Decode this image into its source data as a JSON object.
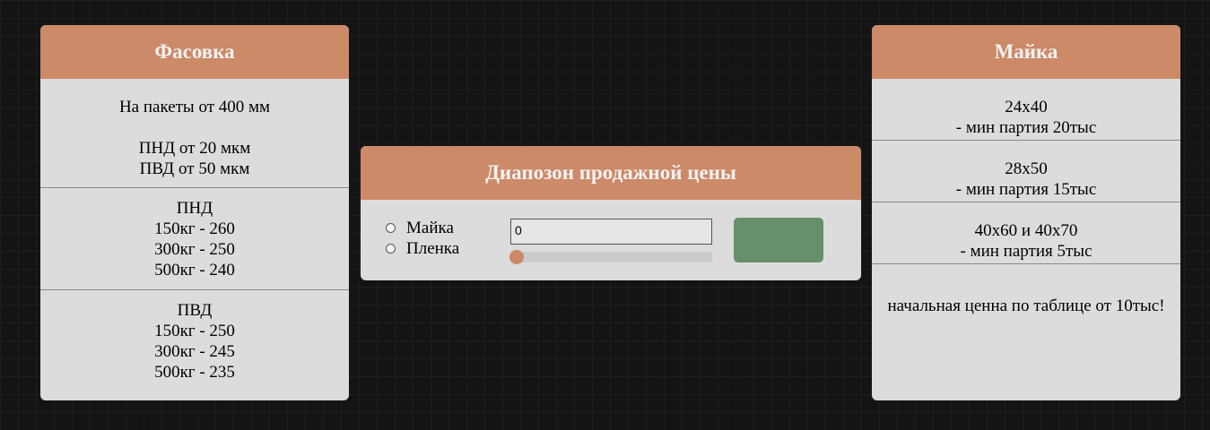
{
  "left_card": {
    "title": "Фасовка",
    "section1": {
      "line1": "На пакеты от 400 мм",
      "line2": "ПНД от 20 мкм",
      "line3": "ПВД от 50 мкм"
    },
    "section2": {
      "heading": "ПНД",
      "rows": [
        "150кг - 260",
        "300кг - 250",
        "500кг - 240"
      ]
    },
    "section3": {
      "heading": "ПВД",
      "rows": [
        "150кг - 250",
        "300кг - 245",
        "500кг - 235"
      ]
    }
  },
  "middle_card": {
    "title": "Диапозон продажной цены",
    "options": [
      "Майка",
      "Пленка"
    ],
    "input_value": "0",
    "slider_value": 0,
    "button_label": "",
    "accent_color": "#cc8a68",
    "button_color": "#668f6a"
  },
  "right_card": {
    "title": "Майка",
    "sizes": [
      {
        "size": "24х40",
        "note": "- мин партия 20тыс"
      },
      {
        "size": "28х50",
        "note": "- мин партия 15тыс"
      },
      {
        "size": "40х60 и 40х70",
        "note": "- мин партия 5тыс"
      }
    ],
    "footnote": "начальная ценна по таблице от 10тыс!"
  }
}
